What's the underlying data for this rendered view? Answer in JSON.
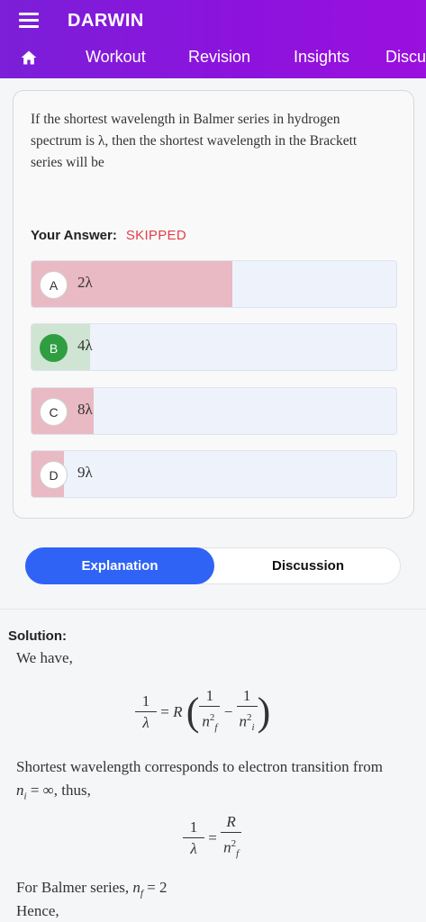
{
  "app": {
    "title": "DARWIN",
    "nav": [
      "Workout",
      "Revision",
      "Insights",
      "Discuss"
    ]
  },
  "question": {
    "text": "If the shortest wavelength in Balmer series in hydrogen spectrum is λ, then the shortest wavelength in the Brackett series will be",
    "your_answer_label": "Your Answer:",
    "your_answer_status": "SKIPPED",
    "options": [
      {
        "letter": "A",
        "text": "2λ",
        "fill_pct": 55,
        "correct": false
      },
      {
        "letter": "B",
        "text": "4λ",
        "fill_pct": 16,
        "correct": true
      },
      {
        "letter": "C",
        "text": "8λ",
        "fill_pct": 17,
        "correct": false
      },
      {
        "letter": "D",
        "text": "9λ",
        "fill_pct": 9,
        "correct": false
      }
    ]
  },
  "tabs": {
    "explanation": "Explanation",
    "discussion": "Discussion"
  },
  "solution": {
    "heading": "Solution:",
    "line1": "We have,",
    "line2": "Shortest wavelength corresponds to electron transition from",
    "line3_suffix": ", thus,",
    "line4_prefix": "For Balmer series,",
    "line5": "Hence,"
  },
  "colors": {
    "appbar": "#8e12dd",
    "active_tab": "#2f63f5",
    "wrong_fill": "#e9bac3",
    "correct_fill": "#cfe4d3",
    "correct_badge": "#2f9e41",
    "skipped": "#e0404a"
  },
  "icons": {
    "menu": "menu-icon",
    "home": "home-icon"
  }
}
